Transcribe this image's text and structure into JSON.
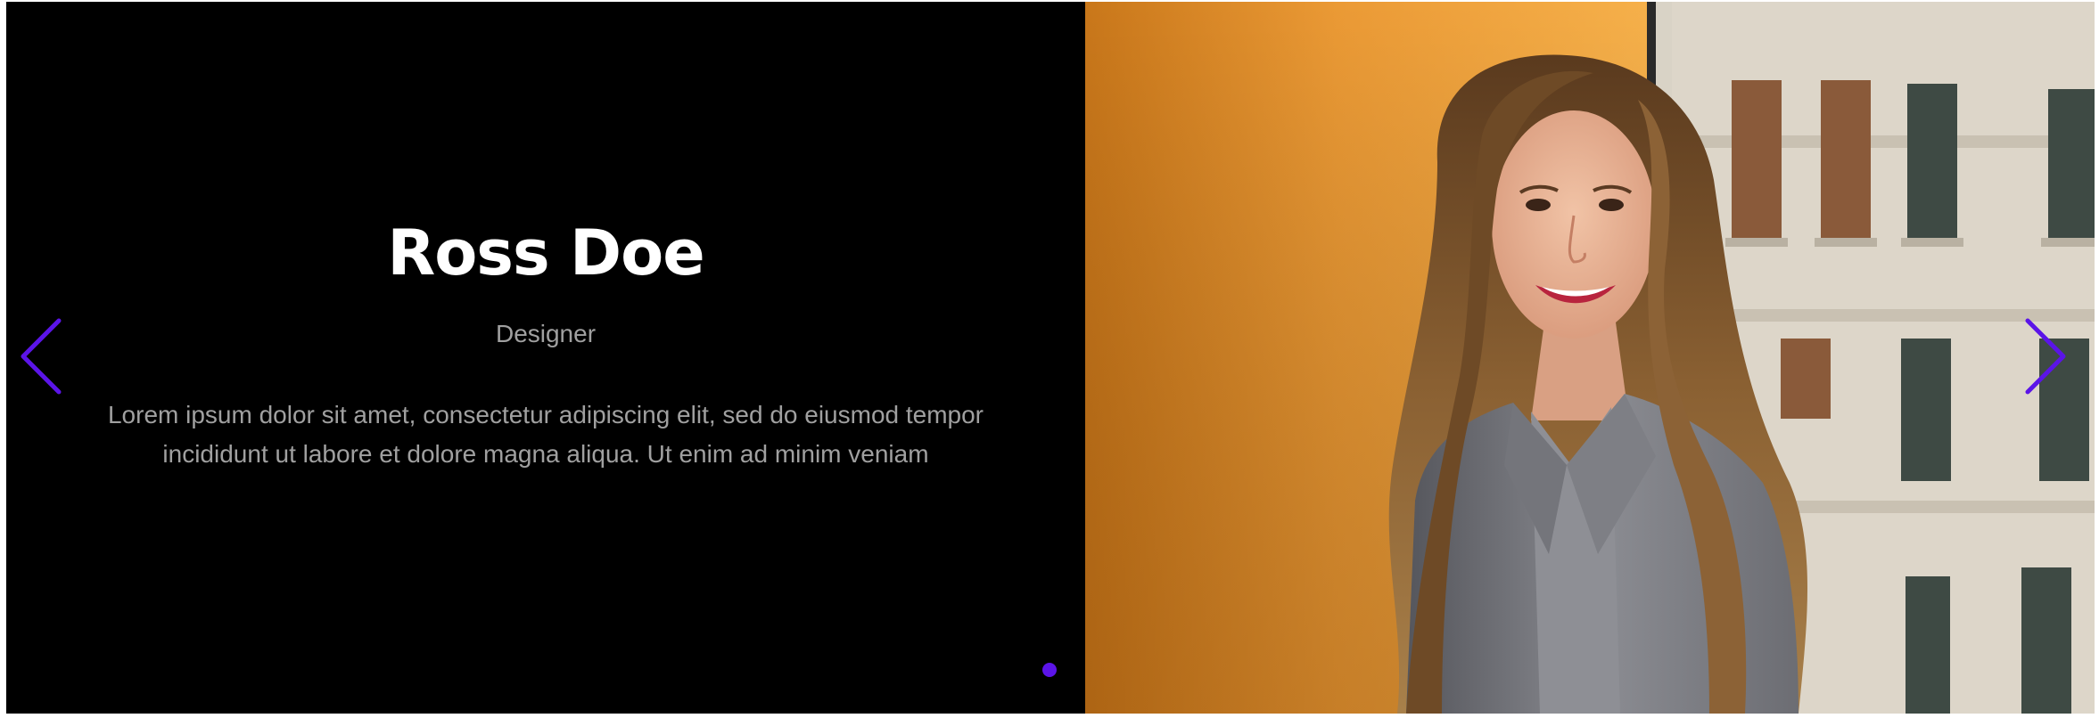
{
  "testimonial": {
    "name": "Ross Doe",
    "role": "Designer",
    "quote": "Lorem ipsum dolor sit amet, consectetur adipiscing elit, sed do eiusmod tempor incididunt ut labore et dolore magna aliqua. Ut enim ad minim veniam",
    "photo_icon": "portrait-photo"
  },
  "controls": {
    "prev_icon": "chevron-left-icon",
    "next_icon": "chevron-right-icon",
    "dots": 1,
    "active_dot": 1
  },
  "colors": {
    "accent": "#5b14e8",
    "background": "#000000",
    "heading": "#ffffff",
    "body_text": "#a0a0a0"
  }
}
